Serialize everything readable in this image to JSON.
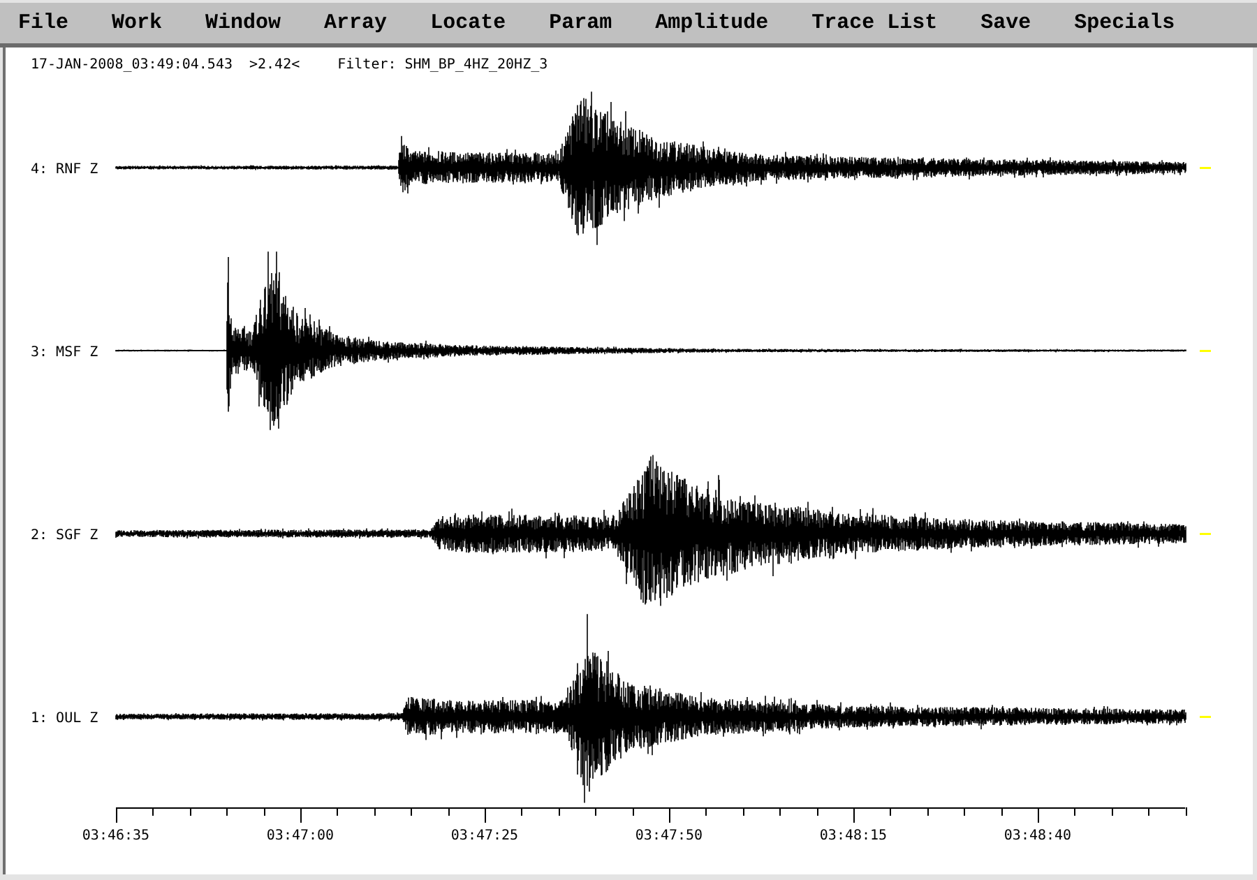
{
  "menu": [
    "File",
    "Work",
    "Window",
    "Array",
    "Locate",
    "Param",
    "Amplitude",
    "Trace List",
    "Save",
    "Specials"
  ],
  "header": {
    "timestamp": "17-JAN-2008_03:49:04.543",
    "amplitude": ">2.42<",
    "filter": "Filter: SHM_BP_4HZ_20HZ_3"
  },
  "traces": [
    {
      "label": "4: RNF Z"
    },
    {
      "label": "3: MSF Z"
    },
    {
      "label": "2: SGF Z"
    },
    {
      "label": "1: OUL Z"
    }
  ],
  "time_axis": {
    "labels": [
      "03:46:35",
      "03:47:00",
      "03:47:25",
      "03:47:50",
      "03:48:15",
      "03:48:40"
    ]
  }
}
